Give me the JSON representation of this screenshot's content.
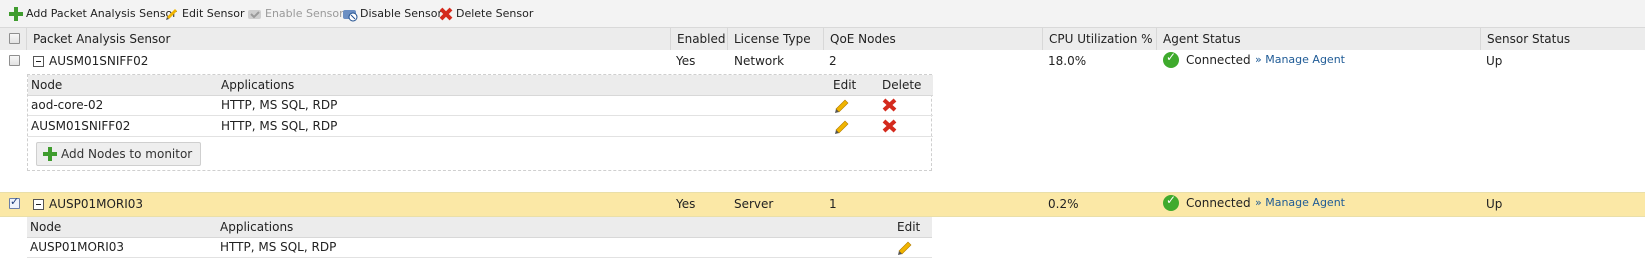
{
  "toolbar": {
    "add": "Add Packet Analysis Sensor",
    "edit": "Edit Sensor",
    "enable": "Enable Sensor",
    "disable": "Disable Sensor",
    "delete": "Delete Sensor"
  },
  "columns": {
    "sensor": "Packet Analysis Sensor",
    "enabled": "Enabled",
    "license": "License Type",
    "qoe": "QoE Nodes",
    "cpu": "CPU Utilization %",
    "agent": "Agent Status",
    "status": "Sensor Status"
  },
  "sensors": [
    {
      "name": "AUSM01SNIFF02",
      "enabled": "Yes",
      "license": "Network",
      "qoe": "2",
      "cpu": "18.0%",
      "agent_status": "Connected",
      "manage_link": "» Manage Agent",
      "sensor_status": "Up",
      "selected": false,
      "sub": {
        "node_header": "Node",
        "apps_header": "Applications",
        "edit_header": "Edit",
        "delete_header": "Delete",
        "rows": [
          {
            "node": "aod-core-02",
            "apps": "HTTP, MS SQL, RDP"
          },
          {
            "node": "AUSM01SNIFF02",
            "apps": "HTTP, MS SQL, RDP"
          }
        ],
        "add_label": "Add Nodes to monitor"
      }
    },
    {
      "name": "AUSP01MORI03",
      "enabled": "Yes",
      "license": "Server",
      "qoe": "1",
      "cpu": "0.2%",
      "agent_status": "Connected",
      "manage_link": "» Manage Agent",
      "sensor_status": "Up",
      "selected": true,
      "sub": {
        "node_header": "Node",
        "apps_header": "Applications",
        "edit_header": "Edit",
        "rows": [
          {
            "node": "AUSP01MORI03",
            "apps": "HTTP, MS SQL, RDP"
          }
        ]
      }
    }
  ],
  "colors": {
    "selected_row": "#fbe8a6",
    "link": "#1f5b96",
    "connected": "#3faa2d"
  }
}
